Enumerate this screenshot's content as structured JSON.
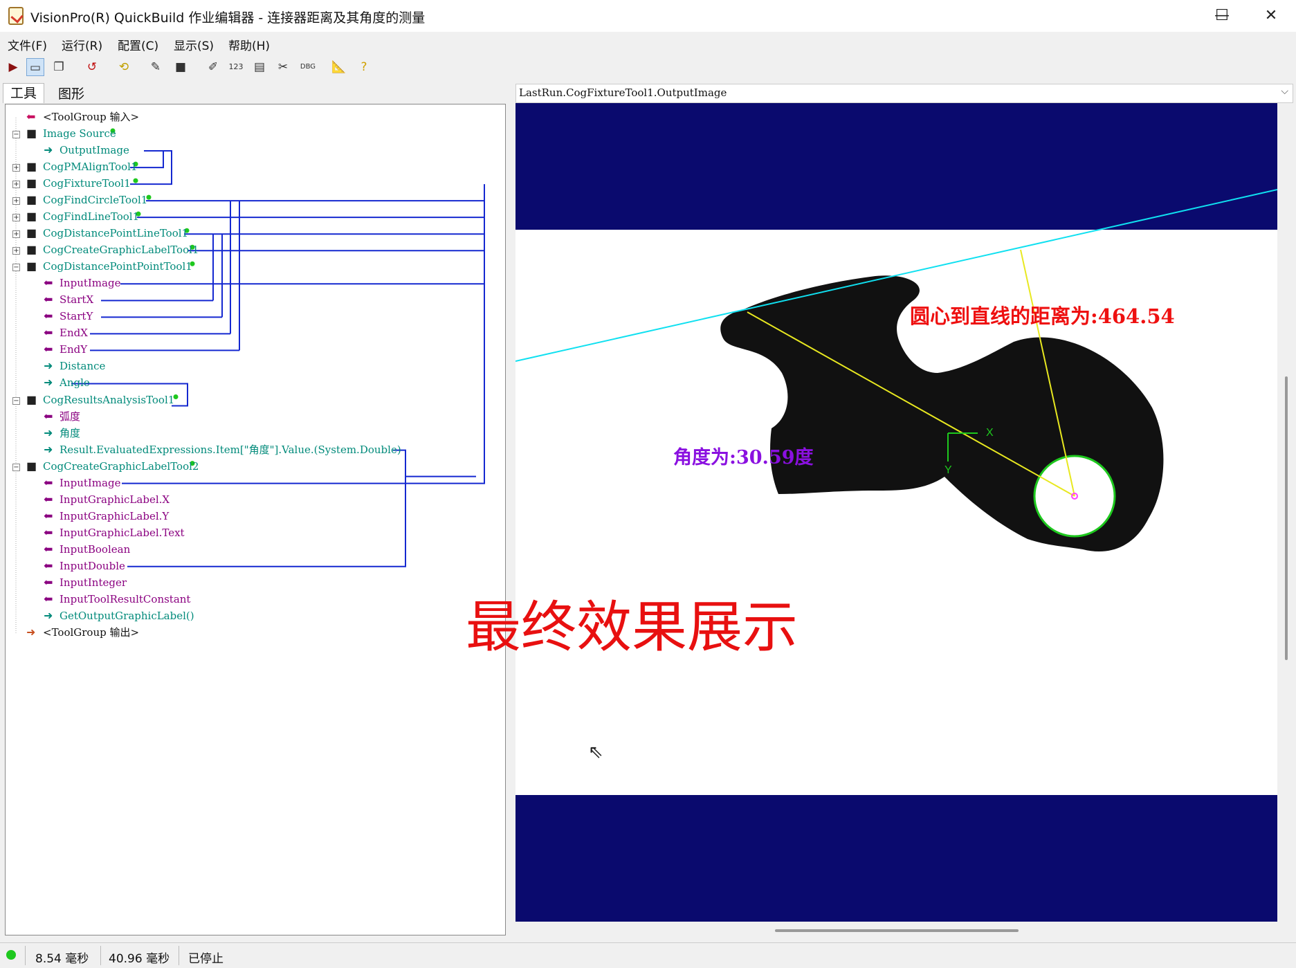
{
  "window": {
    "title": "VisionPro(R) QuickBuild 作业编辑器 - 连接器距离及其角度的测量",
    "minimize": "—",
    "maximize": "☐",
    "close": "✕"
  },
  "menu": [
    "文件(F)",
    "运行(R)",
    "配置(C)",
    "显示(S)",
    "帮助(H)"
  ],
  "toolbar_icons": [
    "run-icon",
    "show-image-icon",
    "copy-icon",
    "reset-icon",
    "loop-icon",
    "brush-icon",
    "camera-icon",
    "edit-icon",
    "number-display-icon",
    "result-grid-icon",
    "tools-icon",
    "debug-icon",
    "ruler-icon",
    "help-icon"
  ],
  "tabs": [
    "工具",
    "图形"
  ],
  "tree": [
    {
      "label": "<ToolGroup 输入>",
      "color": "black"
    },
    {
      "label": "Image Source",
      "color": "green"
    },
    {
      "label": "OutputImage",
      "color": "green"
    },
    {
      "label": "CogPMAlignTool1",
      "color": "green"
    },
    {
      "label": "CogFixtureTool1",
      "color": "green"
    },
    {
      "label": "CogFindCircleTool1",
      "color": "green"
    },
    {
      "label": "CogFindLineTool1",
      "color": "green"
    },
    {
      "label": "CogDistancePointLineTool1",
      "color": "green"
    },
    {
      "label": "CogCreateGraphicLabelTool1",
      "color": "green"
    },
    {
      "label": "CogDistancePointPointTool1",
      "color": "green"
    },
    {
      "label": "InputImage",
      "color": "purple"
    },
    {
      "label": "StartX",
      "color": "purple"
    },
    {
      "label": "StartY",
      "color": "purple"
    },
    {
      "label": "EndX",
      "color": "purple"
    },
    {
      "label": "EndY",
      "color": "purple"
    },
    {
      "label": "Distance",
      "color": "green"
    },
    {
      "label": "Angle",
      "color": "green"
    },
    {
      "label": "CogResultsAnalysisTool1",
      "color": "green"
    },
    {
      "label": "弧度",
      "color": "purple"
    },
    {
      "label": "角度",
      "color": "green"
    },
    {
      "label": "Result.EvaluatedExpressions.Item[\"角度\"].Value.(System.Double)",
      "color": "green"
    },
    {
      "label": "CogCreateGraphicLabelTool2",
      "color": "green"
    },
    {
      "label": "InputImage",
      "color": "purple"
    },
    {
      "label": "InputGraphicLabel.X",
      "color": "purple"
    },
    {
      "label": "InputGraphicLabel.Y",
      "color": "purple"
    },
    {
      "label": "InputGraphicLabel.Text",
      "color": "purple"
    },
    {
      "label": "InputBoolean",
      "color": "purple"
    },
    {
      "label": "InputDouble",
      "color": "purple"
    },
    {
      "label": "InputInteger",
      "color": "purple"
    },
    {
      "label": "InputToolResultConstant",
      "color": "purple"
    },
    {
      "label": "GetOutputGraphicLabel()",
      "color": "green"
    },
    {
      "label": "<ToolGroup 输出>",
      "color": "black"
    }
  ],
  "viewer": {
    "source": "LastRun.CogFixtureTool1.OutputImage",
    "distance_label": "圆心到直线的距离为:464.54",
    "angle_label": "角度为:30.59度",
    "axis_x": "X",
    "axis_y": "Y",
    "caption": "最终效果展示"
  },
  "status": {
    "time1": "8.54 毫秒",
    "time2": "40.96 毫秒",
    "state": "已停止"
  },
  "colors": {
    "tree_green": "#008a7a",
    "tree_purple": "#8a0080",
    "link_blue": "#1428d0",
    "viewer_band": "#0a0a6e",
    "line_cyan": "#10e0f0",
    "measure_yellow": "#e8e820",
    "distance_label": "#ee1010",
    "angle_label": "#8a10e0",
    "caption": "#e81010"
  }
}
